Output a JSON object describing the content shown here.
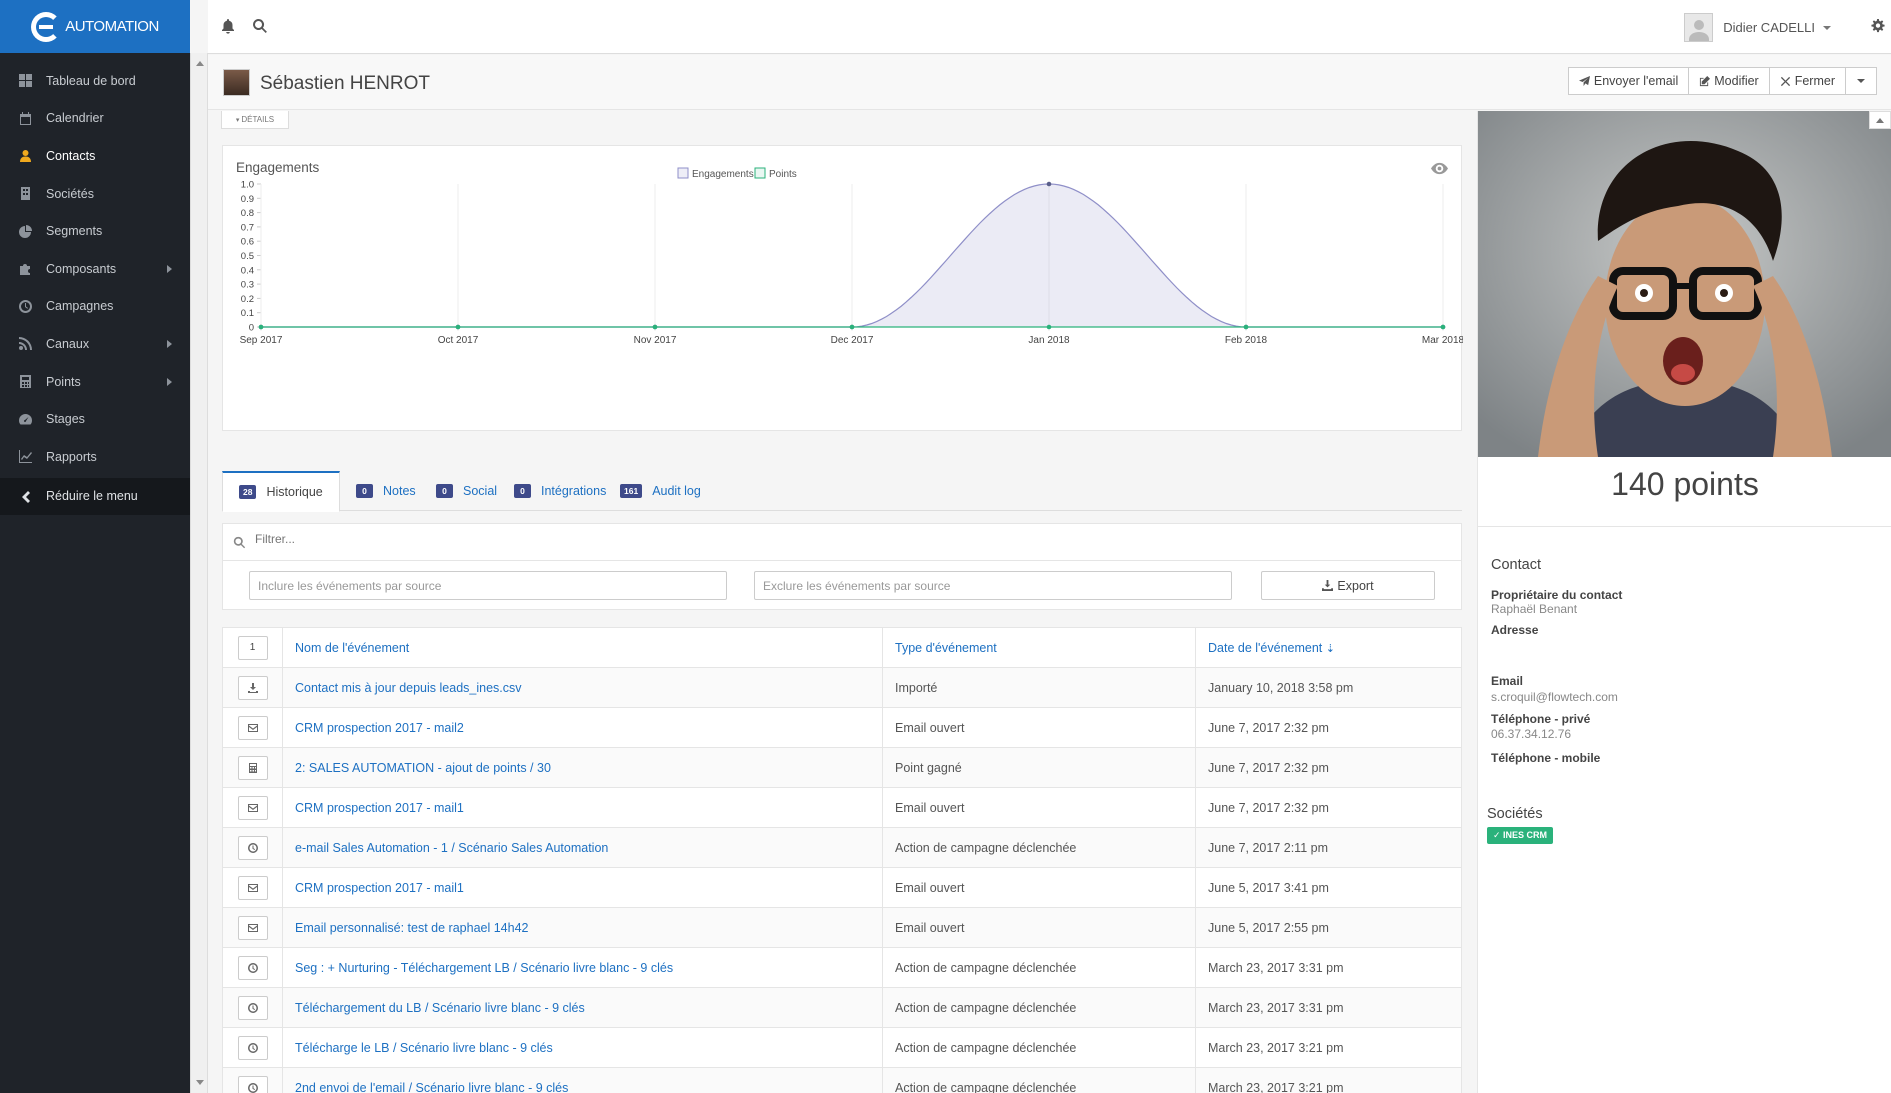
{
  "app": {
    "logo_text": "AUTOMATION",
    "brand_color": "#1d70c2"
  },
  "sidebar": {
    "items": [
      {
        "label": "Tableau de bord",
        "icon": "dashboard-icon"
      },
      {
        "label": "Calendrier",
        "icon": "calendar-icon"
      },
      {
        "label": "Contacts",
        "icon": "user-icon",
        "active": true
      },
      {
        "label": "Sociétés",
        "icon": "building-icon"
      },
      {
        "label": "Segments",
        "icon": "pie-icon"
      },
      {
        "label": "Composants",
        "icon": "puzzle-icon",
        "submenu": true
      },
      {
        "label": "Campagnes",
        "icon": "clock-icon"
      },
      {
        "label": "Canaux",
        "icon": "rss-icon",
        "submenu": true
      },
      {
        "label": "Points",
        "icon": "calculator-icon",
        "submenu": true
      },
      {
        "label": "Stages",
        "icon": "tachometer-icon"
      },
      {
        "label": "Rapports",
        "icon": "line-chart-icon"
      }
    ],
    "collapse_label": "Réduire le menu"
  },
  "topbar": {
    "user_name": "Didier CADELLI"
  },
  "header": {
    "contact_name": "Sébastien HENROT",
    "buttons": {
      "send_email": "Envoyer l'email",
      "edit": "Modifier",
      "close": "Fermer"
    },
    "details_label": "DÉTAILS"
  },
  "chart_panel": {
    "title": "Engagements"
  },
  "chart_data": {
    "type": "line",
    "categories": [
      "Sep 2017",
      "Oct 2017",
      "Nov 2017",
      "Dec 2017",
      "Jan 2018",
      "Feb 2018",
      "Mar 2018"
    ],
    "series": [
      {
        "name": "Engagements",
        "values": [
          0,
          0,
          0,
          0,
          1,
          0,
          0
        ],
        "color": "#8f8fc8",
        "fill": "rgba(143,143,200,0.18)"
      },
      {
        "name": "Points",
        "values": [
          0,
          0,
          0,
          0,
          0,
          0,
          0
        ],
        "color": "#2ab27b"
      }
    ],
    "ylim": [
      0,
      1
    ],
    "yticks": [
      "1.0",
      "0.9",
      "0.8",
      "0.7",
      "0.6",
      "0.5",
      "0.4",
      "0.3",
      "0.2",
      "0.1",
      "0"
    ],
    "legend": "top-center",
    "grid": true
  },
  "tabs": [
    {
      "count": "28",
      "label": "Historique",
      "active": true
    },
    {
      "count": "0",
      "label": "Notes"
    },
    {
      "count": "0",
      "label": "Social"
    },
    {
      "count": "0",
      "label": "Intégrations"
    },
    {
      "count": "161",
      "label": "Audit log"
    }
  ],
  "filter": {
    "placeholder": "Filtrer...",
    "include_placeholder": "Inclure les événements par source",
    "exclude_placeholder": "Exclure les événements par source",
    "export_label": "Export"
  },
  "table": {
    "sort_button": "1",
    "headers": {
      "name": "Nom de l'événement",
      "type": "Type d'événement",
      "date": "Date de l'événement"
    },
    "rows": [
      {
        "icon": "download-icon",
        "name": "Contact mis à jour depuis leads_ines.csv",
        "type": "Importé",
        "date": "January 10, 2018 3:58 pm"
      },
      {
        "icon": "envelope-icon",
        "name": "CRM prospection 2017 - mail2",
        "type": "Email ouvert",
        "date": "June 7, 2017 2:32 pm"
      },
      {
        "icon": "calculator-icon",
        "name": "2: SALES AUTOMATION - ajout de points / 30",
        "type": "Point gagné",
        "date": "June 7, 2017 2:32 pm"
      },
      {
        "icon": "envelope-icon",
        "name": "CRM prospection 2017 - mail1",
        "type": "Email ouvert",
        "date": "June 7, 2017 2:32 pm"
      },
      {
        "icon": "clock-icon",
        "name": "e-mail Sales Automation - 1 / Scénario Sales Automation",
        "type": "Action de campagne déclenchée",
        "date": "June 7, 2017 2:11 pm"
      },
      {
        "icon": "envelope-icon",
        "name": "CRM prospection 2017 - mail1",
        "type": "Email ouvert",
        "date": "June 5, 2017 3:41 pm"
      },
      {
        "icon": "envelope-icon",
        "name": "Email personnalisé: test de raphael 14h42",
        "type": "Email ouvert",
        "date": "June 5, 2017 2:55 pm"
      },
      {
        "icon": "clock-icon",
        "name": "Seg : + Nurturing - Téléchargement LB / Scénario livre blanc - 9 clés",
        "type": "Action de campagne déclenchée",
        "date": "March 23, 2017 3:31 pm"
      },
      {
        "icon": "clock-icon",
        "name": "Téléchargement du LB / Scénario livre blanc - 9 clés",
        "type": "Action de campagne déclenchée",
        "date": "March 23, 2017 3:31 pm"
      },
      {
        "icon": "clock-icon",
        "name": "Télécharge le LB / Scénario livre blanc - 9 clés",
        "type": "Action de campagne déclenchée",
        "date": "March 23, 2017 3:21 pm"
      },
      {
        "icon": "clock-icon",
        "name": "2nd envoi de l'email / Scénario livre blanc - 9 clés",
        "type": "Action de campagne déclenchée",
        "date": "March 23, 2017 3:21 pm"
      }
    ]
  },
  "contact_panel": {
    "points": "140 points",
    "section_title": "Contact",
    "owner_label": "Propriétaire du contact",
    "owner_value": "Raphaël Benant",
    "address_label": "Adresse",
    "email_label": "Email",
    "email_value": "s.croquil@flowtech.com",
    "phone_private_label": "Téléphone - privé",
    "phone_private_value": "06.37.34.12.76",
    "phone_mobile_label": "Téléphone - mobile",
    "companies_title": "Sociétés",
    "company_tag": "INES CRM"
  }
}
